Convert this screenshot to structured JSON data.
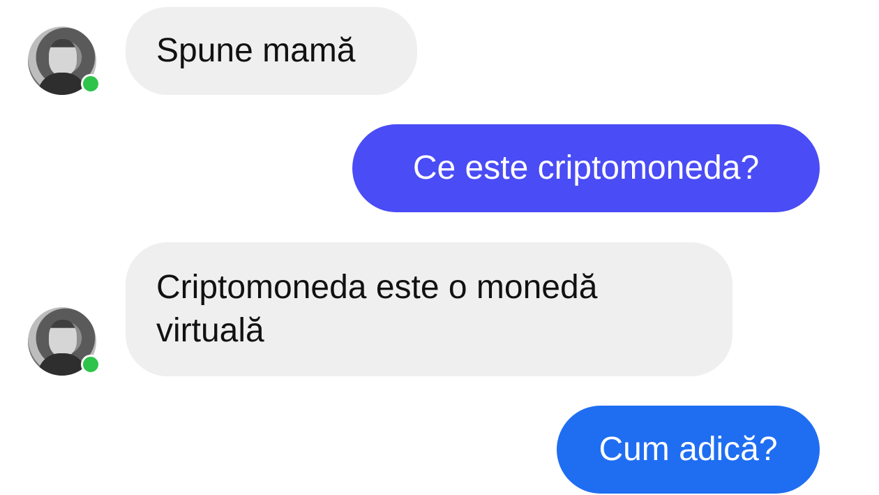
{
  "messages": [
    {
      "direction": "incoming",
      "text": "Spune mamă"
    },
    {
      "direction": "outgoing",
      "text": "Ce este criptomoneda?"
    },
    {
      "direction": "incoming",
      "text": "Criptomoneda este o monedă virtuală"
    },
    {
      "direction": "outgoing",
      "text": "Cum adică?"
    }
  ],
  "colors": {
    "incoming_bubble": "#efefef",
    "outgoing_bubble_1": "#4a4cf5",
    "outgoing_bubble_2": "#1f6ef2",
    "online_indicator": "#2ec34a"
  },
  "icons": {
    "avatar": "contact-avatar-photo",
    "status": "online-status-dot"
  }
}
